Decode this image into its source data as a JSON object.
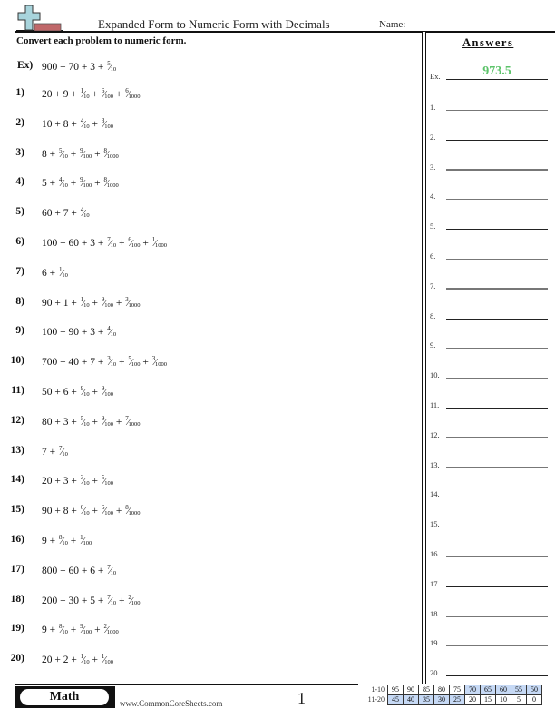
{
  "header": {
    "title": "Expanded Form to Numeric Form with Decimals",
    "name_label": "Name:",
    "logo_colors": {
      "cross": "#a8d4dc",
      "bar": "#c0686a"
    }
  },
  "instructions": "Convert each problem to numeric form.",
  "example": {
    "label": "Ex)",
    "whole_terms": [
      "900",
      "70",
      "3"
    ],
    "fractions": [
      {
        "n": "5",
        "d": "10"
      }
    ],
    "answer_label": "Ex.",
    "answer": "973.5",
    "answer_color": "#5cc36a"
  },
  "problems": [
    {
      "label": "1)",
      "whole_terms": [
        "20",
        "9"
      ],
      "fractions": [
        {
          "n": "1",
          "d": "10"
        },
        {
          "n": "6",
          "d": "100"
        },
        {
          "n": "6",
          "d": "1000"
        }
      ]
    },
    {
      "label": "2)",
      "whole_terms": [
        "10",
        "8"
      ],
      "fractions": [
        {
          "n": "4",
          "d": "10"
        },
        {
          "n": "3",
          "d": "100"
        }
      ]
    },
    {
      "label": "3)",
      "whole_terms": [
        "8"
      ],
      "fractions": [
        {
          "n": "5",
          "d": "10"
        },
        {
          "n": "9",
          "d": "100"
        },
        {
          "n": "8",
          "d": "1000"
        }
      ]
    },
    {
      "label": "4)",
      "whole_terms": [
        "5"
      ],
      "fractions": [
        {
          "n": "4",
          "d": "10"
        },
        {
          "n": "9",
          "d": "100"
        },
        {
          "n": "8",
          "d": "1000"
        }
      ]
    },
    {
      "label": "5)",
      "whole_terms": [
        "60",
        "7"
      ],
      "fractions": [
        {
          "n": "4",
          "d": "10"
        }
      ]
    },
    {
      "label": "6)",
      "whole_terms": [
        "100",
        "60",
        "3"
      ],
      "fractions": [
        {
          "n": "7",
          "d": "10"
        },
        {
          "n": "6",
          "d": "100"
        },
        {
          "n": "1",
          "d": "1000"
        }
      ]
    },
    {
      "label": "7)",
      "whole_terms": [
        "6"
      ],
      "fractions": [
        {
          "n": "1",
          "d": "10"
        }
      ]
    },
    {
      "label": "8)",
      "whole_terms": [
        "90",
        "1"
      ],
      "fractions": [
        {
          "n": "1",
          "d": "10"
        },
        {
          "n": "9",
          "d": "100"
        },
        {
          "n": "3",
          "d": "1000"
        }
      ]
    },
    {
      "label": "9)",
      "whole_terms": [
        "100",
        "90",
        "3"
      ],
      "fractions": [
        {
          "n": "4",
          "d": "10"
        }
      ]
    },
    {
      "label": "10)",
      "whole_terms": [
        "700",
        "40",
        "7"
      ],
      "fractions": [
        {
          "n": "3",
          "d": "10"
        },
        {
          "n": "5",
          "d": "100"
        },
        {
          "n": "3",
          "d": "1000"
        }
      ]
    },
    {
      "label": "11)",
      "whole_terms": [
        "50",
        "6"
      ],
      "fractions": [
        {
          "n": "9",
          "d": "10"
        },
        {
          "n": "9",
          "d": "100"
        }
      ]
    },
    {
      "label": "12)",
      "whole_terms": [
        "80",
        "3"
      ],
      "fractions": [
        {
          "n": "5",
          "d": "10"
        },
        {
          "n": "9",
          "d": "100"
        },
        {
          "n": "7",
          "d": "1000"
        }
      ]
    },
    {
      "label": "13)",
      "whole_terms": [
        "7"
      ],
      "fractions": [
        {
          "n": "7",
          "d": "10"
        }
      ]
    },
    {
      "label": "14)",
      "whole_terms": [
        "20",
        "3"
      ],
      "fractions": [
        {
          "n": "3",
          "d": "10"
        },
        {
          "n": "5",
          "d": "100"
        }
      ]
    },
    {
      "label": "15)",
      "whole_terms": [
        "90",
        "8"
      ],
      "fractions": [
        {
          "n": "6",
          "d": "10"
        },
        {
          "n": "6",
          "d": "100"
        },
        {
          "n": "8",
          "d": "1000"
        }
      ]
    },
    {
      "label": "16)",
      "whole_terms": [
        "9"
      ],
      "fractions": [
        {
          "n": "8",
          "d": "10"
        },
        {
          "n": "1",
          "d": "100"
        }
      ]
    },
    {
      "label": "17)",
      "whole_terms": [
        "800",
        "60",
        "6"
      ],
      "fractions": [
        {
          "n": "7",
          "d": "10"
        }
      ]
    },
    {
      "label": "18)",
      "whole_terms": [
        "200",
        "30",
        "5"
      ],
      "fractions": [
        {
          "n": "7",
          "d": "10"
        },
        {
          "n": "2",
          "d": "100"
        }
      ]
    },
    {
      "label": "19)",
      "whole_terms": [
        "9"
      ],
      "fractions": [
        {
          "n": "8",
          "d": "10"
        },
        {
          "n": "9",
          "d": "100"
        },
        {
          "n": "2",
          "d": "1000"
        }
      ]
    },
    {
      "label": "20)",
      "whole_terms": [
        "20",
        "2"
      ],
      "fractions": [
        {
          "n": "1",
          "d": "10"
        },
        {
          "n": "1",
          "d": "100"
        }
      ]
    }
  ],
  "answers": {
    "title": "Answers",
    "labels": [
      "1.",
      "2.",
      "3.",
      "4.",
      "5.",
      "6.",
      "7.",
      "8.",
      "9.",
      "10.",
      "11.",
      "12.",
      "13.",
      "14.",
      "15.",
      "16.",
      "17.",
      "18.",
      "19.",
      "20."
    ]
  },
  "footer": {
    "subject": "Math",
    "website": "www.CommonCoreSheets.com",
    "page_number": "1",
    "score_table": {
      "rows": [
        {
          "label": "1-10",
          "scores": [
            "95",
            "90",
            "85",
            "80",
            "75",
            "70",
            "65",
            "60",
            "55",
            "50"
          ],
          "highlight": [
            false,
            false,
            false,
            false,
            false,
            true,
            true,
            true,
            true,
            true
          ]
        },
        {
          "label": "11-20",
          "scores": [
            "45",
            "40",
            "35",
            "30",
            "25",
            "20",
            "15",
            "10",
            "5",
            "0"
          ],
          "highlight": [
            true,
            true,
            true,
            true,
            true,
            false,
            false,
            false,
            false,
            false
          ]
        }
      ],
      "highlight_color": "#c6d9f5"
    }
  }
}
